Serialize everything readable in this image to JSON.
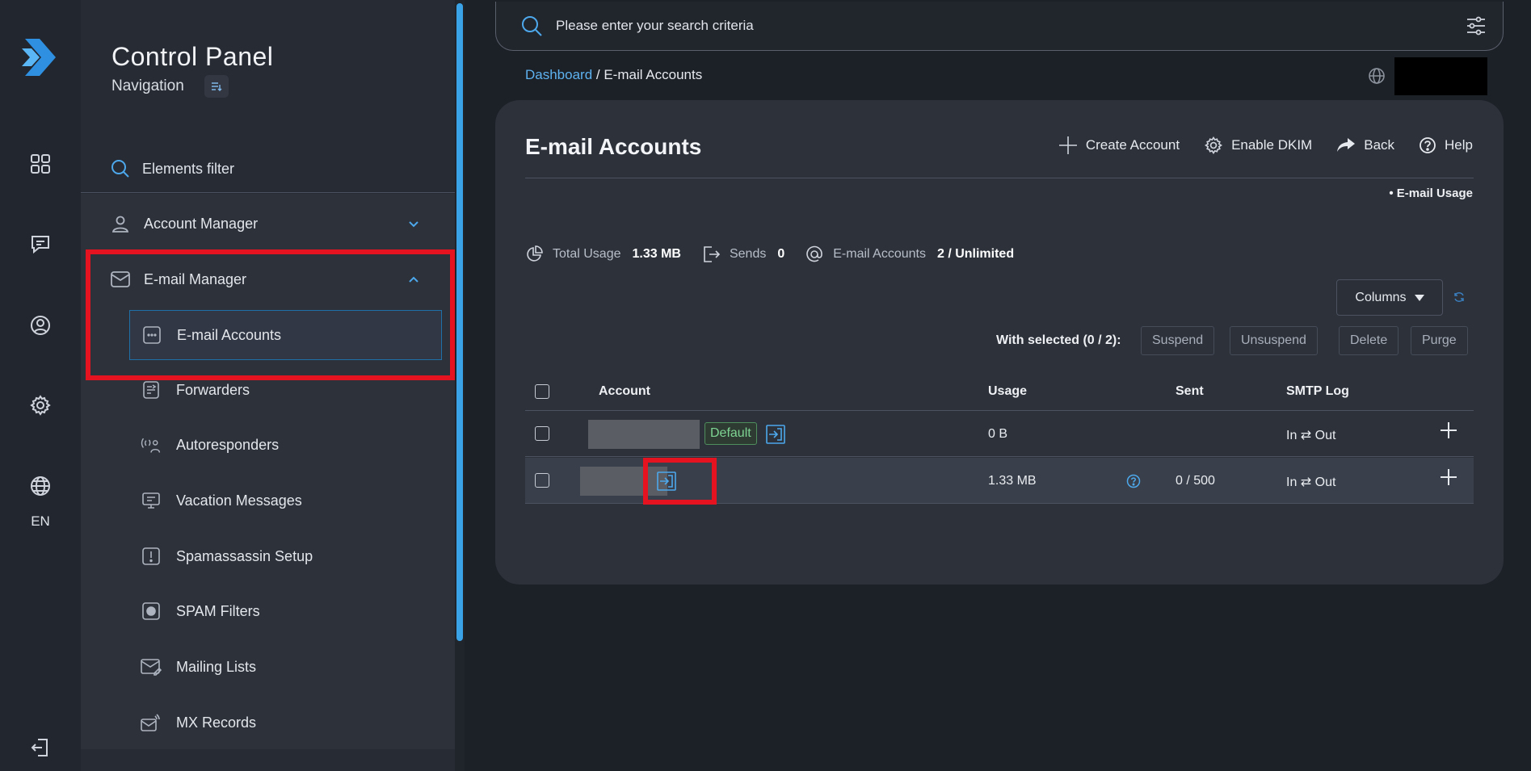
{
  "rail": {
    "lang": "EN"
  },
  "sidebar": {
    "title": "Control Panel",
    "nav_label": "Navigation",
    "filter_label": "Elements filter",
    "sections": [
      {
        "label": "Account Manager"
      },
      {
        "label": "E-mail Manager"
      }
    ],
    "items": [
      {
        "label": "E-mail Accounts",
        "icon": "card-icon"
      },
      {
        "label": "Forwarders",
        "icon": "forward-list-icon"
      },
      {
        "label": "Autoresponders",
        "icon": "broadcast-person-icon"
      },
      {
        "label": "Vacation Messages",
        "icon": "monitor-icon"
      },
      {
        "label": "Spamassassin Setup",
        "icon": "alert-box-icon"
      },
      {
        "label": "SPAM Filters",
        "icon": "spam-filter-icon"
      },
      {
        "label": "Mailing Lists",
        "icon": "mail-pen-icon"
      },
      {
        "label": "MX Records",
        "icon": "mail-signal-icon"
      }
    ]
  },
  "search": {
    "placeholder": "Please enter your search criteria"
  },
  "breadcrumb": {
    "home": "Dashboard",
    "separator": " / ",
    "current": "E-mail Accounts"
  },
  "main": {
    "title": "E-mail Accounts",
    "toolbar": {
      "create": "Create Account",
      "dkim": "Enable DKIM",
      "back": "Back",
      "help": "Help"
    },
    "email_usage_link": "• E-mail Usage",
    "stats": {
      "total_usage_label": "Total Usage",
      "total_usage_value": "1.33 MB",
      "sends_label": "Sends",
      "sends_value": "0",
      "accounts_label": "E-mail Accounts",
      "accounts_value": "2 / Unlimited"
    },
    "columns_label": "Columns",
    "with_selected": "With selected (0 / 2):",
    "bulk_actions": {
      "suspend": "Suspend",
      "unsuspend": "Unsuspend",
      "delete": "Delete",
      "purge": "Purge"
    },
    "table": {
      "headers": {
        "account": "Account",
        "usage": "Usage",
        "sent": "Sent",
        "smtp_log": "SMTP Log"
      },
      "rows": [
        {
          "badge": "Default",
          "usage": "0 B",
          "sent": "",
          "smtp": "In ⇄ Out"
        },
        {
          "badge": "",
          "usage": "1.33 MB",
          "sent": "0 / 500",
          "smtp": "In ⇄ Out"
        }
      ]
    }
  },
  "colors": {
    "accent": "#3aa3e8",
    "highlight": "#e5121f",
    "badge_green": "#7ed492"
  }
}
